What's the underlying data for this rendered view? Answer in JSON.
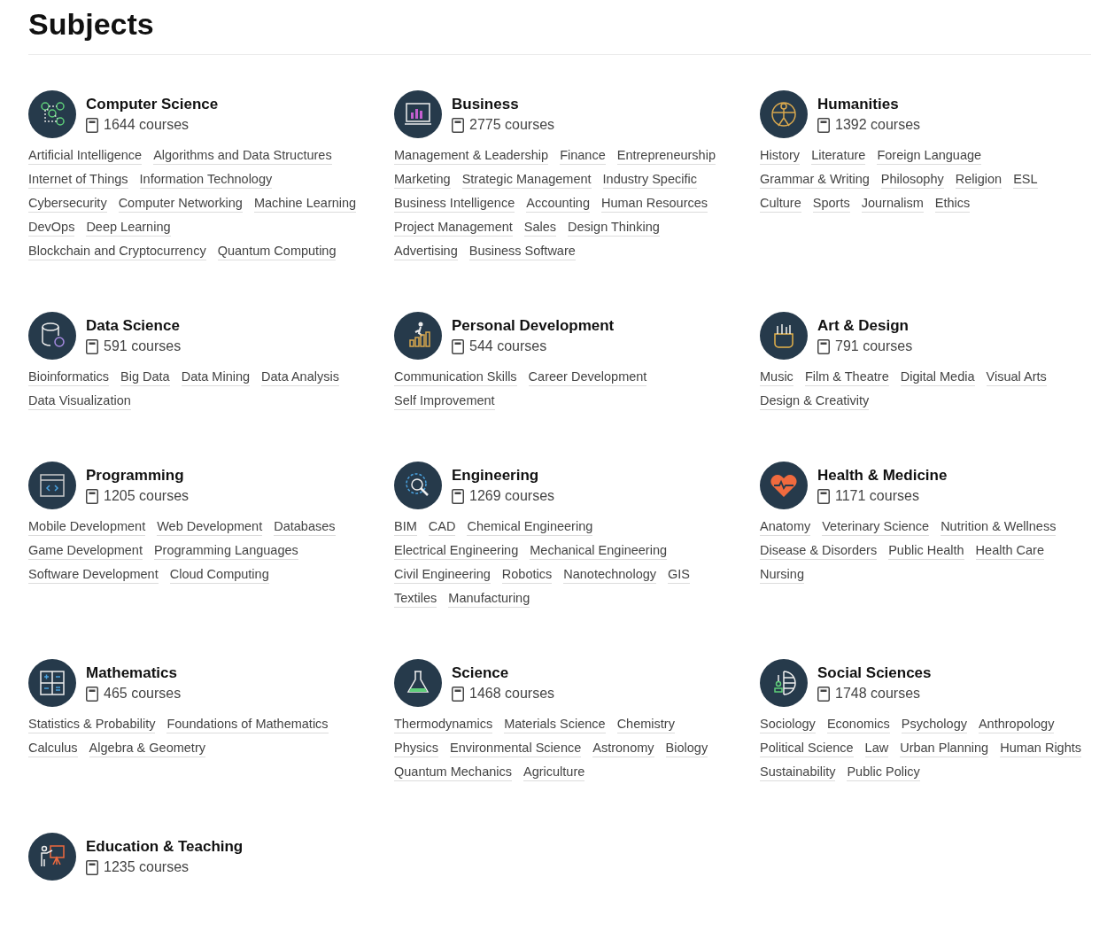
{
  "page_title": "Subjects",
  "subjects": [
    {
      "name": "Computer Science",
      "count": "1644 courses",
      "topics": [
        "Artificial Intelligence",
        "Algorithms and Data Structures",
        "Internet of Things",
        "Information Technology",
        "Cybersecurity",
        "Computer Networking",
        "Machine Learning",
        "DevOps",
        "Deep Learning",
        "Blockchain and Cryptocurrency",
        "Quantum Computing"
      ]
    },
    {
      "name": "Business",
      "count": "2775 courses",
      "topics": [
        "Management & Leadership",
        "Finance",
        "Entrepreneurship",
        "Marketing",
        "Strategic Management",
        "Industry Specific",
        "Business Intelligence",
        "Accounting",
        "Human Resources",
        "Project Management",
        "Sales",
        "Design Thinking",
        "Advertising",
        "Business Software"
      ]
    },
    {
      "name": "Humanities",
      "count": "1392 courses",
      "topics": [
        "History",
        "Literature",
        "Foreign Language",
        "Grammar & Writing",
        "Philosophy",
        "Religion",
        "ESL",
        "Culture",
        "Sports",
        "Journalism",
        "Ethics"
      ]
    },
    {
      "name": "Data Science",
      "count": "591 courses",
      "topics": [
        "Bioinformatics",
        "Big Data",
        "Data Mining",
        "Data Analysis",
        "Data Visualization"
      ]
    },
    {
      "name": "Personal Development",
      "count": "544 courses",
      "topics": [
        "Communication Skills",
        "Career Development",
        "Self Improvement"
      ]
    },
    {
      "name": "Art & Design",
      "count": "791 courses",
      "topics": [
        "Music",
        "Film & Theatre",
        "Digital Media",
        "Visual Arts",
        "Design & Creativity"
      ]
    },
    {
      "name": "Programming",
      "count": "1205 courses",
      "topics": [
        "Mobile Development",
        "Web Development",
        "Databases",
        "Game Development",
        "Programming Languages",
        "Software Development",
        "Cloud Computing"
      ]
    },
    {
      "name": "Engineering",
      "count": "1269 courses",
      "topics": [
        "BIM",
        "CAD",
        "Chemical Engineering",
        "Electrical Engineering",
        "Mechanical Engineering",
        "Civil Engineering",
        "Robotics",
        "Nanotechnology",
        "GIS",
        "Textiles",
        "Manufacturing"
      ]
    },
    {
      "name": "Health & Medicine",
      "count": "1171 courses",
      "topics": [
        "Anatomy",
        "Veterinary Science",
        "Nutrition & Wellness",
        "Disease & Disorders",
        "Public Health",
        "Health Care",
        "Nursing"
      ]
    },
    {
      "name": "Mathematics",
      "count": "465 courses",
      "topics": [
        "Statistics & Probability",
        "Foundations of Mathematics",
        "Calculus",
        "Algebra & Geometry"
      ]
    },
    {
      "name": "Science",
      "count": "1468 courses",
      "topics": [
        "Thermodynamics",
        "Materials Science",
        "Chemistry",
        "Physics",
        "Environmental Science",
        "Astronomy",
        "Biology",
        "Quantum Mechanics",
        "Agriculture"
      ]
    },
    {
      "name": "Social Sciences",
      "count": "1748 courses",
      "topics": [
        "Sociology",
        "Economics",
        "Psychology",
        "Anthropology",
        "Political Science",
        "Law",
        "Urban Planning",
        "Human Rights",
        "Sustainability",
        "Public Policy"
      ]
    },
    {
      "name": "Education & Teaching",
      "count": "1235 courses"
    }
  ]
}
